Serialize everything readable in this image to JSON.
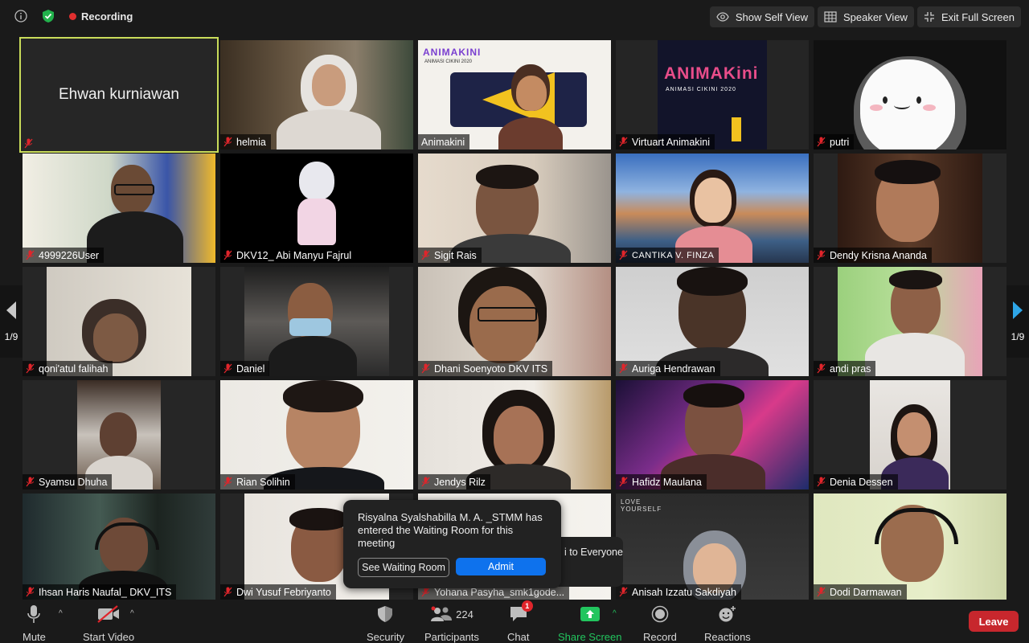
{
  "topbar": {
    "recording_label": "Recording",
    "show_self_view": "Show Self View",
    "speaker_view": "Speaker View",
    "exit_full_screen": "Exit Full Screen"
  },
  "pagination": {
    "left": "1/9",
    "right": "1/9"
  },
  "participants": [
    {
      "name": "Ehwan kurniawan",
      "big_name": "Ehwan kurniawan",
      "active": true
    },
    {
      "name": "helmia"
    },
    {
      "name": "Animakini"
    },
    {
      "name": "Virtuart Animakini"
    },
    {
      "name": "putri"
    },
    {
      "name": "4999226User"
    },
    {
      "name": "DKV12_ Abi Manyu Fajrul"
    },
    {
      "name": "Sigit Rais"
    },
    {
      "name": "CANTIKA V. FINZA"
    },
    {
      "name": "Dendy Krisna Ananda"
    },
    {
      "name": "qoni'atul falihah"
    },
    {
      "name": "Daniel"
    },
    {
      "name": "Dhani Soenyoto DKV ITS"
    },
    {
      "name": "Auriga Hendrawan"
    },
    {
      "name": "andi pras"
    },
    {
      "name": "Syamsu Dhuha"
    },
    {
      "name": "Rian Solihin"
    },
    {
      "name": "Jendys Rilz"
    },
    {
      "name": "Hafidz Maulana"
    },
    {
      "name": "Denia Dessen"
    },
    {
      "name": "Ihsan Haris Naufal_ DKV_ITS"
    },
    {
      "name": "Dwi Yusuf Febriyanto"
    },
    {
      "name": "Yohana Pasyha_smk1gode..."
    },
    {
      "name": "Anisah Izzatu Sakdiyah"
    },
    {
      "name": "Dodi Darmawan"
    }
  ],
  "tile_art": {
    "animakini_banner": "ANIMAKINI",
    "animakini_sub": "ANIMASI CIKINI 2020",
    "animakini_logo": "ANIMAKini",
    "animakini_logo_sub": "ANIMASI CIKINI 2020",
    "poster_text": "LOVE YOURSELF"
  },
  "waiting_room": {
    "message": "Risyalna Syalshabilla M. A. _STMM has entered the Waiting Room for this meeting",
    "see_waiting_room": "See Waiting Room",
    "admit": "Admit"
  },
  "chat_popup": {
    "text": "i to Everyone"
  },
  "bottombar": {
    "mute": "Mute",
    "start_video": "Start Video",
    "security": "Security",
    "participants": "Participants",
    "participant_count": "224",
    "chat": "Chat",
    "chat_badge": "1",
    "share_screen": "Share Screen",
    "record": "Record",
    "reactions": "Reactions",
    "leave": "Leave"
  },
  "colors": {
    "active_speaker": "#c9dc5a",
    "recording_dot": "#e02f2f",
    "share_green": "#22c55e",
    "admit_blue": "#0e72ed",
    "leave_red": "#c7272d",
    "muted_red": "#e0252b"
  }
}
